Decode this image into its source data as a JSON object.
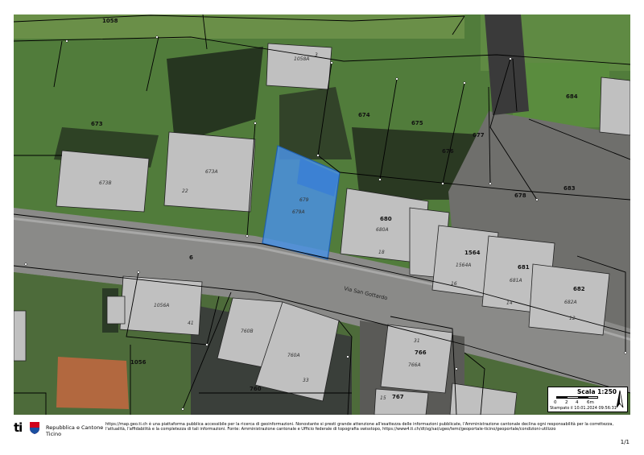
{
  "map": {
    "parcels": [
      "1058",
      "673",
      "674",
      "675",
      "676",
      "677",
      "678",
      "684",
      "683",
      "680",
      "1564",
      "681",
      "682",
      "6",
      "1056",
      "760",
      "766",
      "767"
    ],
    "buildings": [
      "1058A",
      "673B",
      "673A",
      "679",
      "680A",
      "1564A",
      "681A",
      "682A",
      "1056A",
      "760B",
      "760A",
      "766A"
    ],
    "house_numbers": [
      "3",
      "22",
      "18",
      "16",
      "14",
      "12",
      "41",
      "31",
      "33",
      "15"
    ],
    "street_name": "Via San Gottardo",
    "highlight_parcel": "679",
    "highlight_building": "679A",
    "colors": {
      "highlight": "#4a90e2",
      "building": "#c0c0c0",
      "parcel_line": "#000000"
    }
  },
  "scale": {
    "title": "Scala 1:250",
    "ticks": [
      "0",
      "2",
      "4",
      "6m"
    ],
    "printed": "Stampato il 10.01.2024 09:56:31",
    "north_icon": "north-arrow"
  },
  "footer": {
    "logo_ti": "ti",
    "logo_line1": "Repubblica e Cantone",
    "logo_line2": "Ticino",
    "disclaimer": "https://map.geo.ti.ch è una piattaforma pubblica accessibile per la ricerca di geoinformazioni. Nonostante si presti grande attenzione all'esattezza delle informazioni pubblicate, l'Amministrazione cantonale declina ogni responsabilità per la correttezza, l'attualità, l'affidabilità e la completezza di tali informazioni. Fonte: Amministrazione cantonale e Ufficio federale di topografia swisstopo, https://www4.ti.ch/dt/sg/sai/ugeo/temi/geoportale-ticino/geoportale/condizioni-utilizzo",
    "page": "1/1"
  }
}
